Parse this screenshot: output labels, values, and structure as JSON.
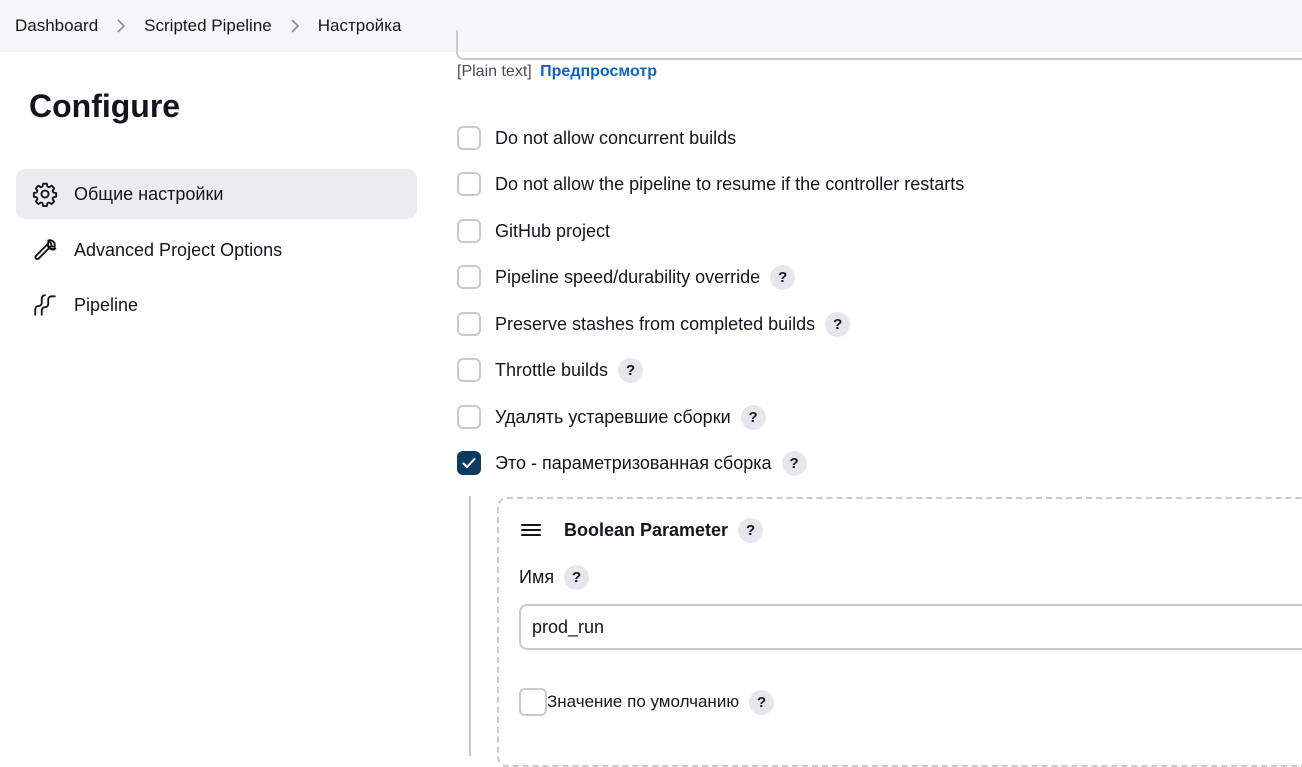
{
  "breadcrumb": [
    "Dashboard",
    "Scripted Pipeline",
    "Настройка"
  ],
  "sidebar": {
    "title": "Configure",
    "items": [
      {
        "label": "Общие настройки",
        "icon": "gear-icon",
        "active": true
      },
      {
        "label": "Advanced Project Options",
        "icon": "wrench-icon",
        "active": false
      },
      {
        "label": "Pipeline",
        "icon": "pipeline-icon",
        "active": false
      }
    ]
  },
  "description": {
    "format": "[Plain text]",
    "preview_link": "Предпросмотр"
  },
  "options": [
    {
      "label": "Do not allow concurrent builds",
      "checked": false,
      "help": false
    },
    {
      "label": "Do not allow the pipeline to resume if the controller restarts",
      "checked": false,
      "help": false
    },
    {
      "label": "GitHub project",
      "checked": false,
      "help": false
    },
    {
      "label": "Pipeline speed/durability override",
      "checked": false,
      "help": true
    },
    {
      "label": "Preserve stashes from completed builds",
      "checked": false,
      "help": true
    },
    {
      "label": "Throttle builds",
      "checked": false,
      "help": true
    },
    {
      "label": "Удалять устаревшие сборки",
      "checked": false,
      "help": true
    },
    {
      "label": "Это - параметризованная сборка",
      "checked": true,
      "help": true
    }
  ],
  "parameter": {
    "title": "Boolean Parameter",
    "name_label": "Имя",
    "name_value": "prod_run",
    "default_label": "Значение по умолчанию",
    "default_checked": false
  },
  "help_glyph": "?",
  "colors": {
    "accent": "#0a3a5e",
    "link": "#0b63c9",
    "active_nav_bg": "#ebebf0",
    "topbar_bg": "#f6f6f8"
  }
}
